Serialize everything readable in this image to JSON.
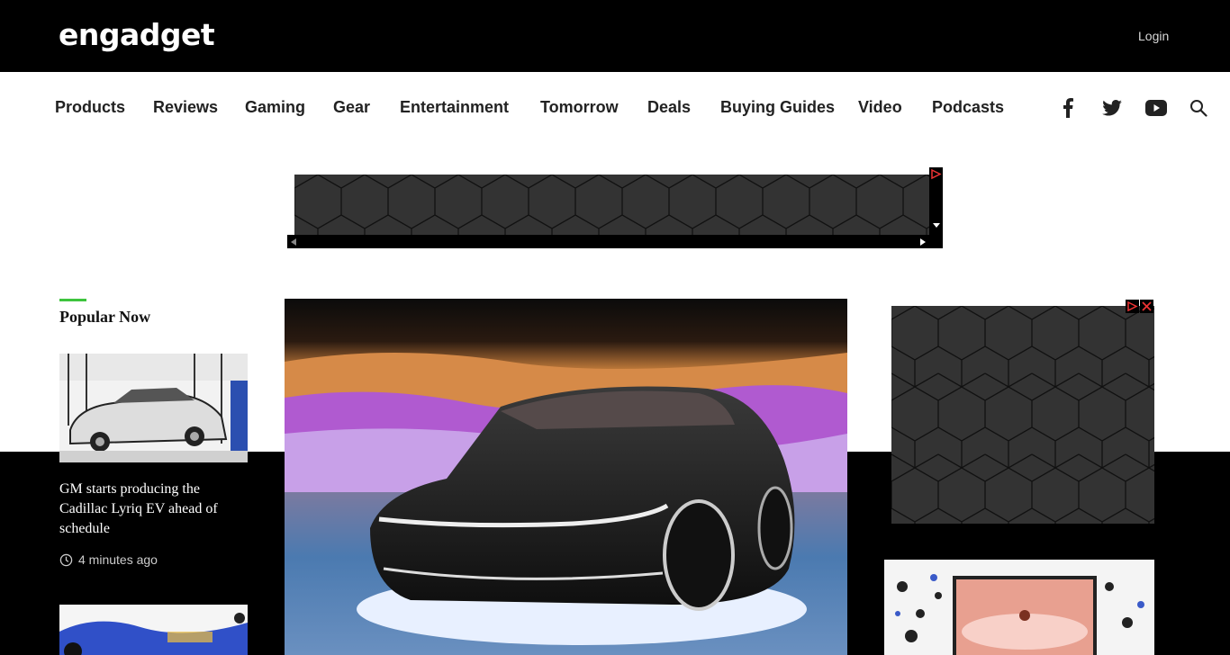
{
  "header": {
    "logo": "engadget",
    "login_label": "Login"
  },
  "nav": {
    "items": [
      {
        "label": "Products"
      },
      {
        "label": "Reviews"
      },
      {
        "label": "Gaming"
      },
      {
        "label": "Gear"
      },
      {
        "label": "Entertainment"
      },
      {
        "label": "Tomorrow"
      },
      {
        "label": "Deals"
      },
      {
        "label": "Buying Guides"
      },
      {
        "label": "Video"
      },
      {
        "label": "Podcasts"
      }
    ],
    "icons": [
      "facebook-icon",
      "twitter-icon",
      "youtube-icon",
      "search-icon"
    ]
  },
  "popular": {
    "title": "Popular Now",
    "stories": [
      {
        "title": "GM starts producing the Cadillac Lyriq EV ahead of schedule",
        "time": "4 minutes ago"
      }
    ]
  },
  "colors": {
    "accent_green": "#3ec43e",
    "topbar": "#000000",
    "ad_bg": "#333333"
  }
}
